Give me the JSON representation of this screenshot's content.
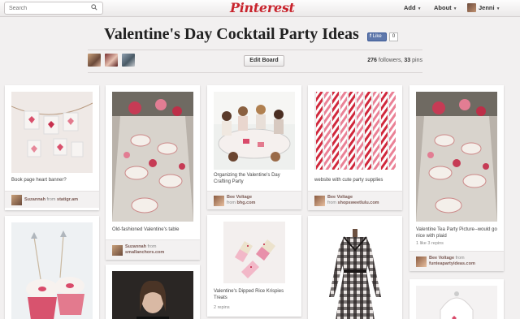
{
  "topbar": {
    "search_placeholder": "Search",
    "logo": "Pinterest",
    "add_label": "Add",
    "about_label": "About",
    "user_name": "Jenni"
  },
  "board": {
    "title": "Valentine's Day Cocktail Party Ideas",
    "like_label": "Like",
    "like_count": "0",
    "edit_label": "Edit Board",
    "followers": "276",
    "followers_label": "followers,",
    "pins": "33",
    "pins_label": "pins"
  },
  "pins": [
    {
      "description": "Book page heart banner?",
      "user": "Suzannah",
      "from": "from",
      "source": "statigr.am"
    },
    {
      "description": "Old-fashioned Valentine's table",
      "user": "Suzannah",
      "from": "from",
      "source": "smallanchors.com"
    },
    {
      "description": "Organizing the Valentine's Day Crafting Party",
      "user": "Bee Voltage",
      "from": "from",
      "source": "bhg.com"
    },
    {
      "description": "website with cute party supplies",
      "user": "Bee Voltage",
      "from": "from",
      "source": "shopsweetlulu.com"
    },
    {
      "description": "Valentine Tea Party Picture--would go nice with plaid",
      "stats": "1 like   3 repins",
      "user": "Bee Voltage",
      "from": "from",
      "source": "funteapartyideas.com"
    },
    {
      "description": "Valentine's Dipped Rice Krispies Treats",
      "stats": "2 repins"
    }
  ],
  "colors": {
    "brand_red": "#c8232c",
    "background": "#f2f0f0",
    "facebook_blue": "#5f78ab"
  }
}
